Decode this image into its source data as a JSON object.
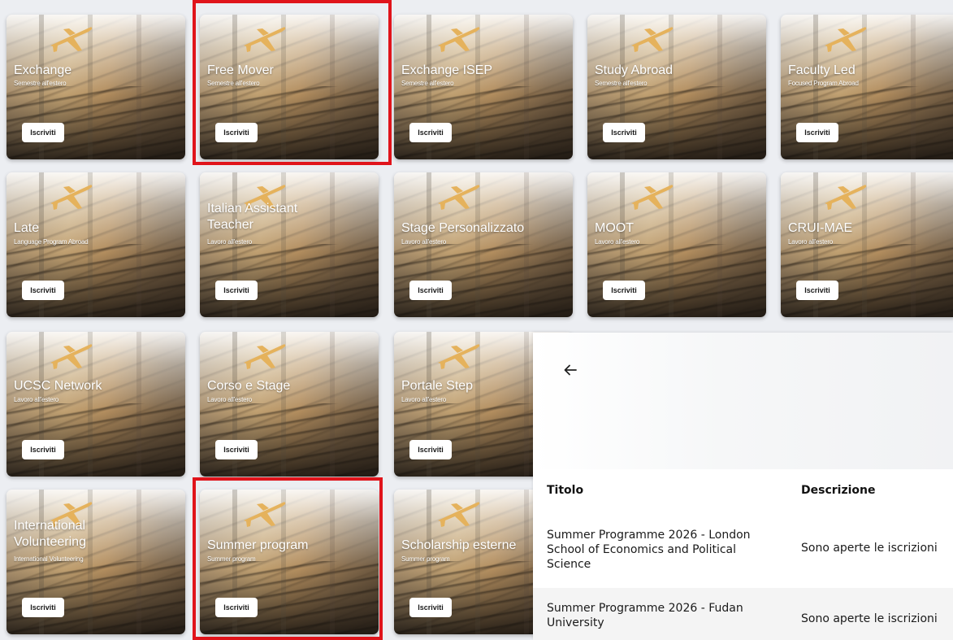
{
  "cards": [
    {
      "title": "Exchange",
      "subtitle": "Semestre all'estero",
      "button": "Iscriviti"
    },
    {
      "title": "Free Mover",
      "subtitle": "Semestre all'estero",
      "button": "Iscriviti"
    },
    {
      "title": "Exchange ISEP",
      "subtitle": "Semestre all'estero",
      "button": "Iscriviti"
    },
    {
      "title": "Study Abroad",
      "subtitle": "Semestre all'estero",
      "button": "Iscriviti"
    },
    {
      "title": "Faculty Led",
      "subtitle": "Focused Program Abroad",
      "button": "Iscriviti"
    },
    {
      "title": "Late",
      "subtitle": "Language Program Abroad",
      "button": "Iscriviti"
    },
    {
      "title": "Italian Assistant Teacher",
      "subtitle": "Lavoro all'estero",
      "button": "Iscriviti"
    },
    {
      "title": "Stage Personalizzato",
      "subtitle": "Lavoro all'estero",
      "button": "Iscriviti"
    },
    {
      "title": "MOOT",
      "subtitle": "Lavoro all'estero",
      "button": "Iscriviti"
    },
    {
      "title": "CRUI-MAE",
      "subtitle": "Lavoro all'estero",
      "button": "Iscriviti"
    },
    {
      "title": "UCSC Network",
      "subtitle": "Lavoro all'estero",
      "button": "Iscriviti"
    },
    {
      "title": "Corso e Stage",
      "subtitle": "Lavoro all'estero",
      "button": "Iscriviti"
    },
    {
      "title": "Portale Step",
      "subtitle": "Lavoro all'estero",
      "button": "Iscriviti"
    },
    {
      "title": "International Volunteering",
      "subtitle": "International Volunteering",
      "button": "Iscriviti"
    },
    {
      "title": "Summer program",
      "subtitle": "Summer program",
      "button": "Iscriviti"
    },
    {
      "title": "Scholarship esterne",
      "subtitle": "Summer program",
      "button": "Iscriviti"
    }
  ],
  "panel": {
    "back_icon": "arrow-left-icon",
    "columns": {
      "title": "Titolo",
      "description": "Descrizione"
    },
    "rows": [
      {
        "title": "Summer Programme 2026 - London School of Economics and Political Science",
        "description": "Sono aperte le iscrizioni"
      },
      {
        "title": "Summer Programme 2026 - Fudan University",
        "description": "Sono aperte le iscrizioni"
      }
    ]
  },
  "colors": {
    "highlight": "#e0141b",
    "card_text": "#ffffff",
    "page_bg": "#eceef2"
  }
}
